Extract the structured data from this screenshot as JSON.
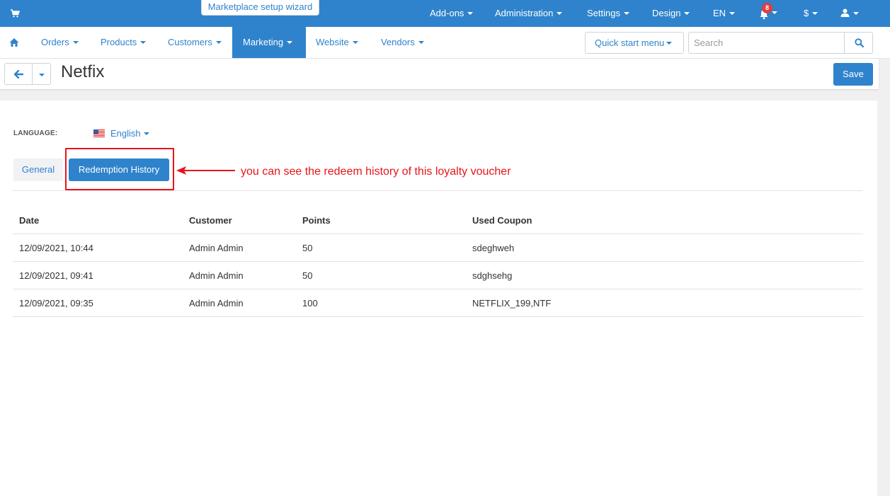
{
  "topbar": {
    "wizard_label": "Marketplace setup wizard",
    "menu": [
      {
        "label": "Add-ons"
      },
      {
        "label": "Administration"
      },
      {
        "label": "Settings"
      },
      {
        "label": "Design"
      },
      {
        "label": "EN"
      },
      {
        "label": "$"
      }
    ],
    "notification_count": "8",
    "icons": [
      "cart-icon",
      "bell-icon",
      "user-icon"
    ]
  },
  "navbar": {
    "items": [
      {
        "label": "Orders"
      },
      {
        "label": "Products"
      },
      {
        "label": "Customers"
      },
      {
        "label": "Marketing"
      },
      {
        "label": "Website"
      },
      {
        "label": "Vendors"
      }
    ],
    "active_item": "Marketing",
    "quick_start_label": "Quick start menu",
    "search": {
      "placeholder": "Search",
      "value": ""
    }
  },
  "titlebar": {
    "title": "Netfix",
    "save_label": "Save"
  },
  "content": {
    "language_label": "LANGUAGE:",
    "language_value": "English",
    "tabs": [
      {
        "label": "General"
      },
      {
        "label": "Redemption History"
      }
    ],
    "active_tab": "Redemption History",
    "annotation": "you can see the redeem history of this loyalty voucher"
  },
  "table": {
    "columns": [
      "Date",
      "Customer",
      "Points",
      "Used Coupon"
    ],
    "rows": [
      [
        "12/09/2021, 10:44",
        "Admin Admin",
        "50",
        "sdeghweh"
      ],
      [
        "12/09/2021, 09:41",
        "Admin Admin",
        "50",
        "sdghsehg"
      ],
      [
        "12/09/2021, 09:35",
        "Admin Admin",
        "100",
        "NETFLIX_199,NTF"
      ]
    ]
  },
  "colors": {
    "brand": "#2f83cc",
    "annotation": "#e8141a",
    "badge": "#e23d3d"
  }
}
